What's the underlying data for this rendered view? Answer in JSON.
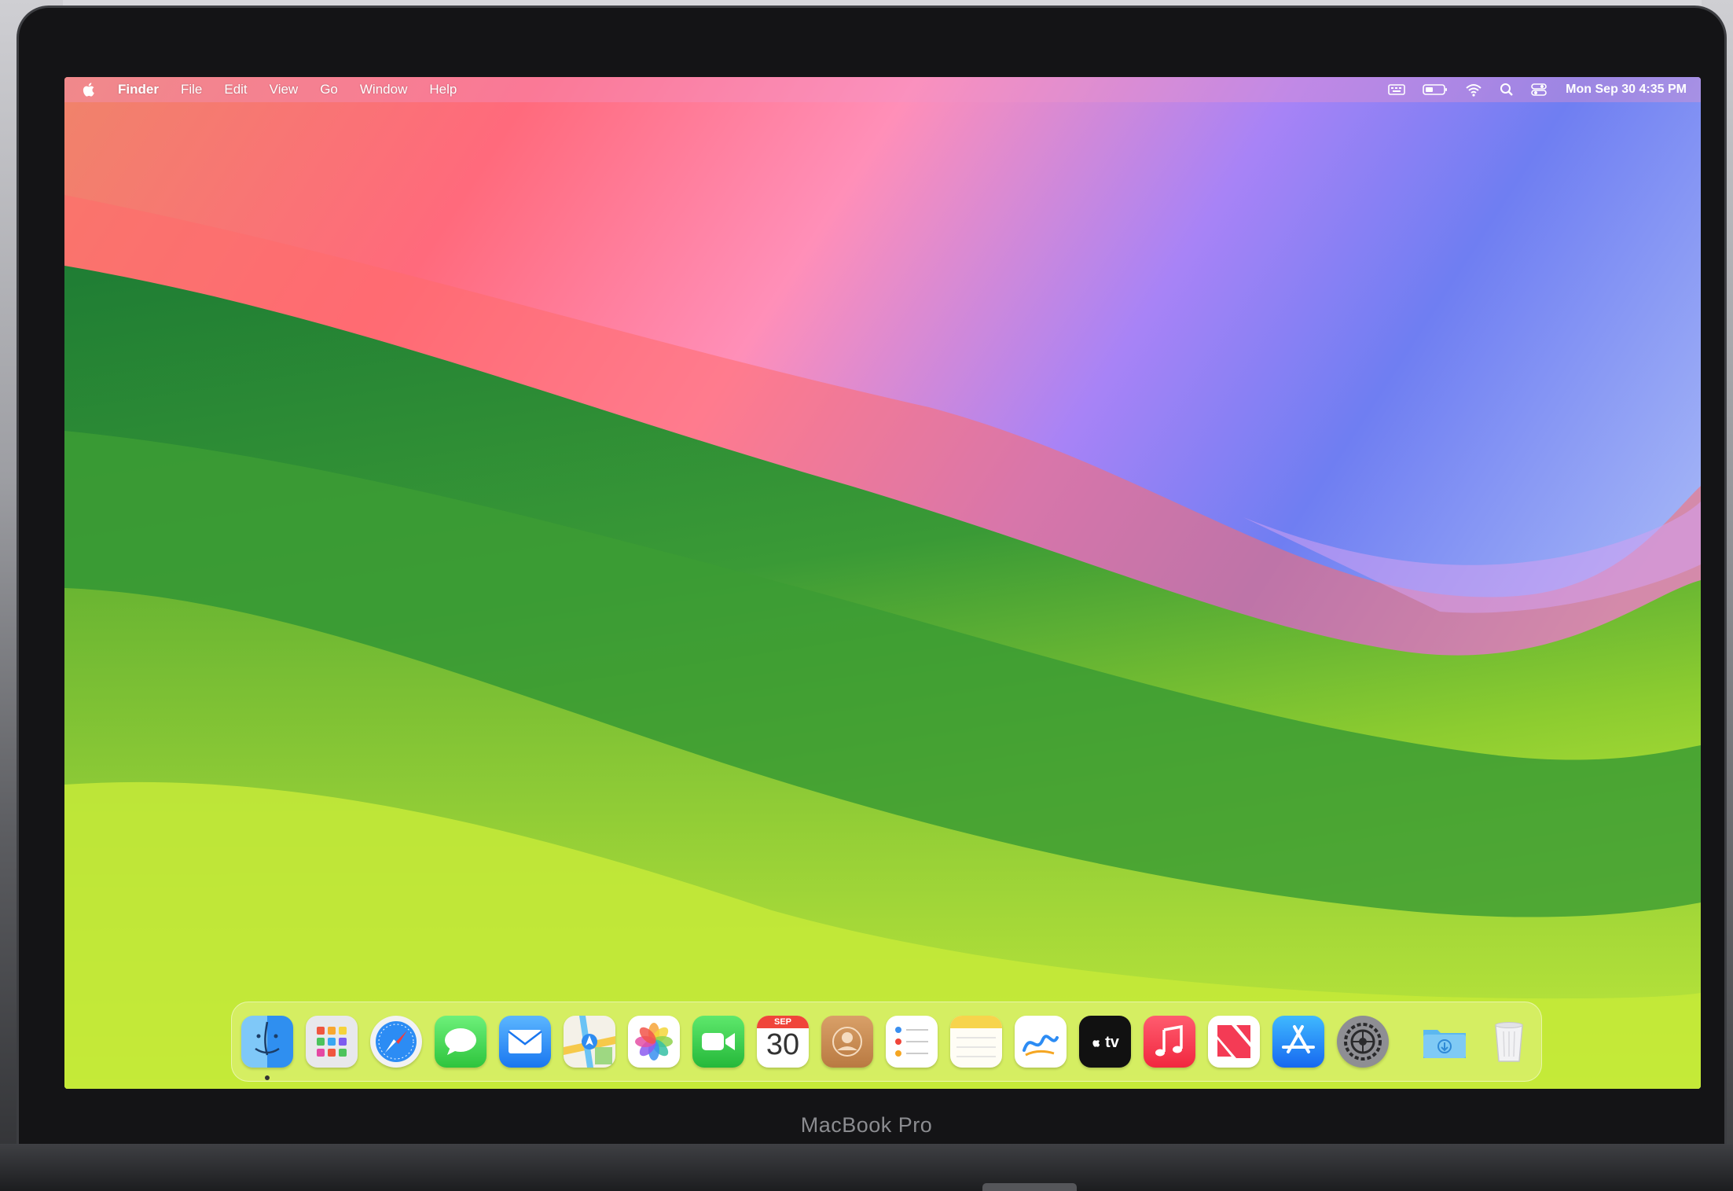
{
  "device": {
    "bezel_label": "MacBook Pro"
  },
  "menu_bar": {
    "app_name": "Finder",
    "menus": [
      "File",
      "Edit",
      "View",
      "Go",
      "Window",
      "Help"
    ],
    "status_icons": [
      "keyboard-icon",
      "battery-icon",
      "wifi-icon",
      "search-icon",
      "control-center-icon"
    ],
    "clock": "Mon Sep 30  4:35 PM"
  },
  "dock": {
    "apps": [
      {
        "name": "Finder",
        "icon": "finder-icon",
        "running": true
      },
      {
        "name": "Launchpad",
        "icon": "launchpad-icon"
      },
      {
        "name": "Safari",
        "icon": "safari-icon"
      },
      {
        "name": "Messages",
        "icon": "messages-icon"
      },
      {
        "name": "Mail",
        "icon": "mail-icon"
      },
      {
        "name": "Maps",
        "icon": "maps-icon"
      },
      {
        "name": "Photos",
        "icon": "photos-icon"
      },
      {
        "name": "FaceTime",
        "icon": "facetime-icon"
      },
      {
        "name": "Calendar",
        "icon": "calendar-icon",
        "month": "SEP",
        "day": "30"
      },
      {
        "name": "Contacts",
        "icon": "contacts-icon"
      },
      {
        "name": "Reminders",
        "icon": "reminders-icon"
      },
      {
        "name": "Notes",
        "icon": "notes-icon"
      },
      {
        "name": "Freeform",
        "icon": "freeform-icon"
      },
      {
        "name": "TV",
        "icon": "tv-icon",
        "label": "tv"
      },
      {
        "name": "Music",
        "icon": "music-icon"
      },
      {
        "name": "News",
        "icon": "news-icon"
      },
      {
        "name": "App Store",
        "icon": "app-store-icon"
      },
      {
        "name": "System Settings",
        "icon": "settings-icon"
      }
    ],
    "stacks": [
      {
        "name": "Downloads",
        "icon": "downloads-folder-icon"
      },
      {
        "name": "Trash",
        "icon": "trash-icon"
      }
    ]
  },
  "colors": {
    "wallpaper_green": "#2f8a3a",
    "wallpaper_lime": "#b8e63a",
    "wallpaper_pink": "#ff7da0",
    "wallpaper_purple": "#8a6ff0"
  }
}
